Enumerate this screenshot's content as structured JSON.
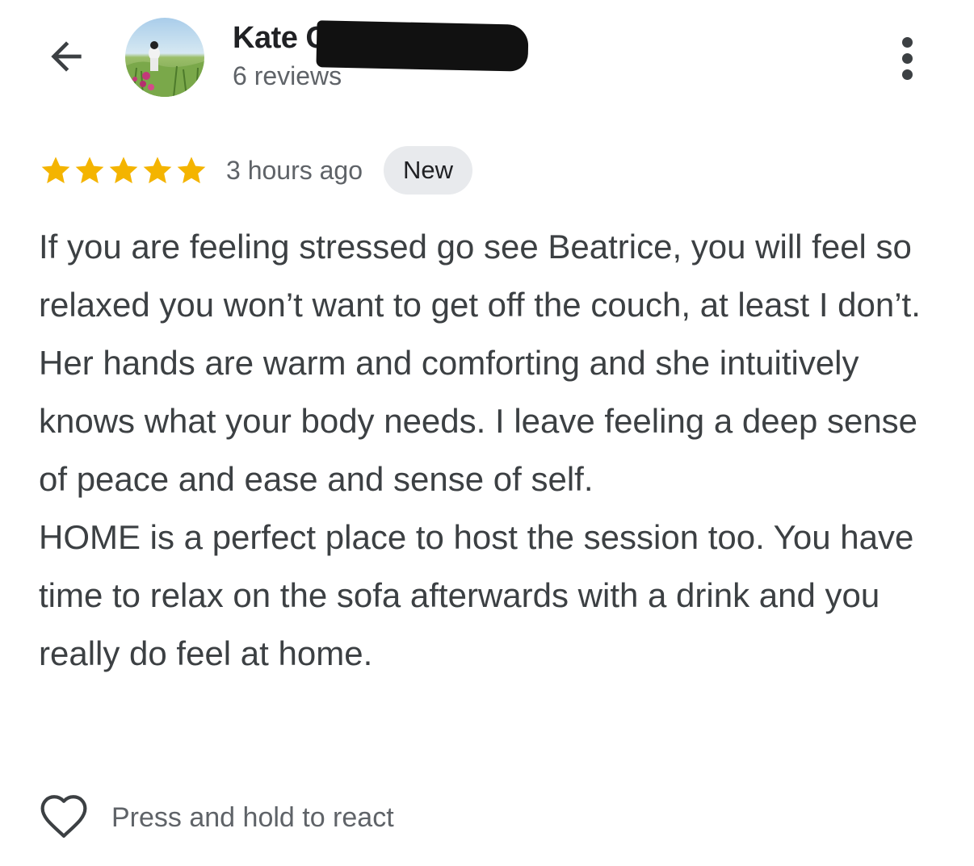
{
  "header": {
    "back_icon": "arrow-back-icon",
    "reviewer_name": "Kate Gunawarra",
    "reviewer_count": "6 reviews",
    "more_icon": "more-vert-icon"
  },
  "review": {
    "rating": 5,
    "rating_max": 5,
    "star_color": "#f4b400",
    "time_ago": "3 hours ago",
    "badge": "New",
    "text": "If you are feeling stressed go see Beatrice, you will feel so relaxed you won’t want to get off the couch, at least I don’t. Her hands are warm and comforting and she intuitively knows what your body needs. I leave feeling a deep sense of peace and ease and sense of self.\nHOME is a perfect place to host the session too. You have time to relax on the sofa afterwards with a drink and you really do feel at home."
  },
  "reaction": {
    "icon": "heart-outline-icon",
    "label": "Press and hold to react"
  }
}
